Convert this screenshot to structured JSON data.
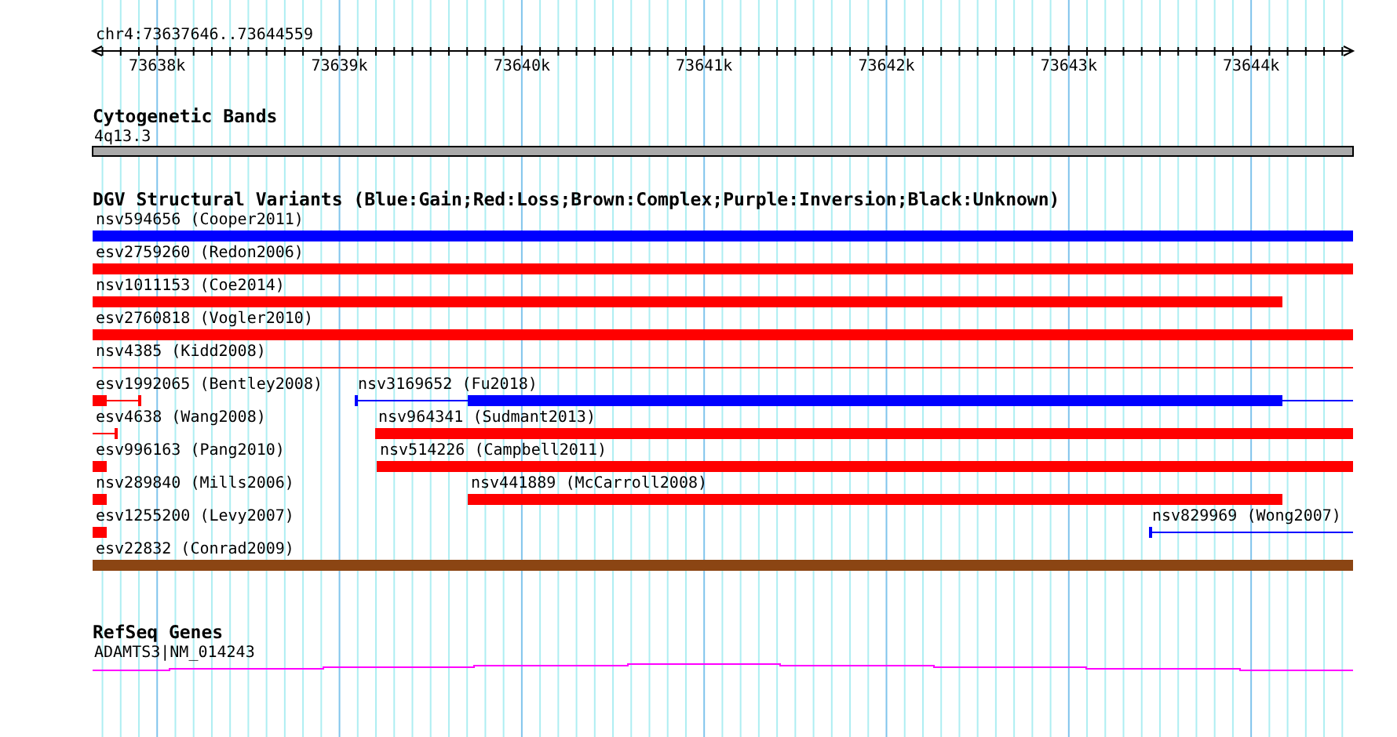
{
  "region": {
    "title": "chr4:73637646..73644559"
  },
  "ruler": {
    "ticks": [
      "73638k",
      "73639k",
      "73640k",
      "73641k",
      "73642k",
      "73643k",
      "73644k"
    ]
  },
  "tracks": [
    {
      "kind": "cytoband",
      "title": "Cytogenetic Bands",
      "features": [
        {
          "label": "4q13.3"
        }
      ]
    },
    {
      "kind": "variants",
      "title": "DGV Structural Variants (Blue:Gain;Red:Loss;Brown:Complex;Purple:Inversion;Black:Unknown)",
      "rows": [
        {
          "features": [
            {
              "label": "nsv594656 (Cooper2011)",
              "kind": "block",
              "color": "#0000ff"
            }
          ]
        },
        {
          "features": [
            {
              "label": "esv2759260 (Redon2006)",
              "kind": "block",
              "color": "#ff0000"
            }
          ]
        },
        {
          "features": [
            {
              "label": "nsv1011153 (Coe2014)",
              "kind": "block",
              "color": "#ff0000"
            }
          ]
        },
        {
          "features": [
            {
              "label": "esv2760818 (Vogler2010)",
              "kind": "block",
              "color": "#ff0000"
            }
          ]
        },
        {
          "features": [
            {
              "label": "nsv4385 (Kidd2008)",
              "kind": "line",
              "color": "#ff0000"
            }
          ]
        },
        {
          "features": [
            {
              "label": "esv1992065 (Bentley2008)",
              "kind": "block",
              "color": "#ff0000"
            },
            {
              "label": "nsv3169652 (Fu2018)",
              "kind": "block",
              "color": "#0000ff"
            }
          ]
        },
        {
          "features": [
            {
              "label": "esv4638 (Wang2008)",
              "kind": "line",
              "color": "#ff0000"
            },
            {
              "label": "nsv964341 (Sudmant2013)",
              "kind": "block",
              "color": "#ff0000"
            }
          ]
        },
        {
          "features": [
            {
              "label": "esv996163 (Pang2010)",
              "kind": "block",
              "color": "#ff0000"
            },
            {
              "label": "nsv514226 (Campbell2011)",
              "kind": "block",
              "color": "#ff0000"
            }
          ]
        },
        {
          "features": [
            {
              "label": "nsv289840 (Mills2006)",
              "kind": "block",
              "color": "#ff0000"
            },
            {
              "label": "nsv441889 (McCarroll2008)",
              "kind": "block",
              "color": "#ff0000"
            }
          ]
        },
        {
          "features": [
            {
              "label": "esv1255200 (Levy2007)",
              "kind": "block",
              "color": "#ff0000"
            },
            {
              "label": "nsv829969 (Wong2007)",
              "kind": "line",
              "color": "#0000ff"
            }
          ]
        },
        {
          "features": [
            {
              "label": "esv22832 (Conrad2009)",
              "kind": "block",
              "color": "#8b4513"
            }
          ]
        }
      ]
    },
    {
      "kind": "genes",
      "title": "RefSeq Genes",
      "features": [
        {
          "label": "ADAMTS3|NM_014243"
        }
      ]
    }
  ]
}
